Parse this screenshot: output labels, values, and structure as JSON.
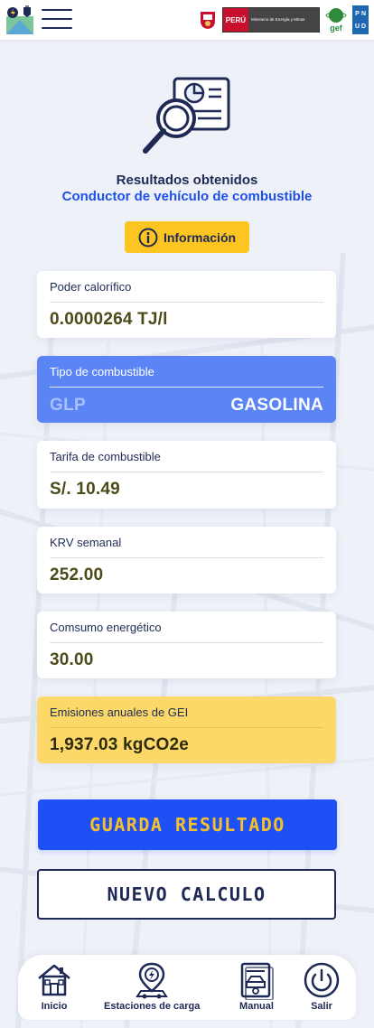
{
  "header": {
    "app_logo": "app-logo-icon",
    "menu": "hamburger-menu-icon",
    "logos": {
      "peru": "PERÚ",
      "ministry": "Ministerio de Energía y Minas",
      "gef": "gef",
      "undp": [
        "P",
        "N",
        "U",
        "D"
      ]
    }
  },
  "page": {
    "title": "Resultados obtenidos",
    "subtitle": "Conductor de vehículo de combustible",
    "info_button": "Información"
  },
  "cards": {
    "calorific": {
      "label": "Poder calorífico",
      "value": "0.0000264 TJ/l"
    },
    "fuel_type": {
      "label": "Tipo de combustible",
      "options": [
        "GLP",
        "GASOLINA"
      ],
      "selected": "GASOLINA"
    },
    "tariff": {
      "label": "Tarifa de combustible",
      "value": "S/. 10.49"
    },
    "krv": {
      "label": "KRV semanal",
      "value": "252.00"
    },
    "energy": {
      "label": "Comsumo energético",
      "value": "30.00"
    },
    "ghg": {
      "label": "Emisiones anuales de GEI",
      "value": "1,937.03 kgCO2e"
    }
  },
  "actions": {
    "save": "GUARDA RESULTADO",
    "new": "NUEVO CALCULO"
  },
  "nav": [
    {
      "label": "Inicio",
      "icon": "home-icon"
    },
    {
      "label": "Estaciones de carga",
      "icon": "charging-station-icon"
    },
    {
      "label": "Manual",
      "icon": "manual-icon"
    },
    {
      "label": "Salir",
      "icon": "power-icon"
    }
  ],
  "colors": {
    "primary_blue": "#1e50f5",
    "navy": "#1e2a55",
    "yellow": "#fcc521",
    "fuel_card": "#5b84f5",
    "ghg_card": "#fcd869"
  }
}
